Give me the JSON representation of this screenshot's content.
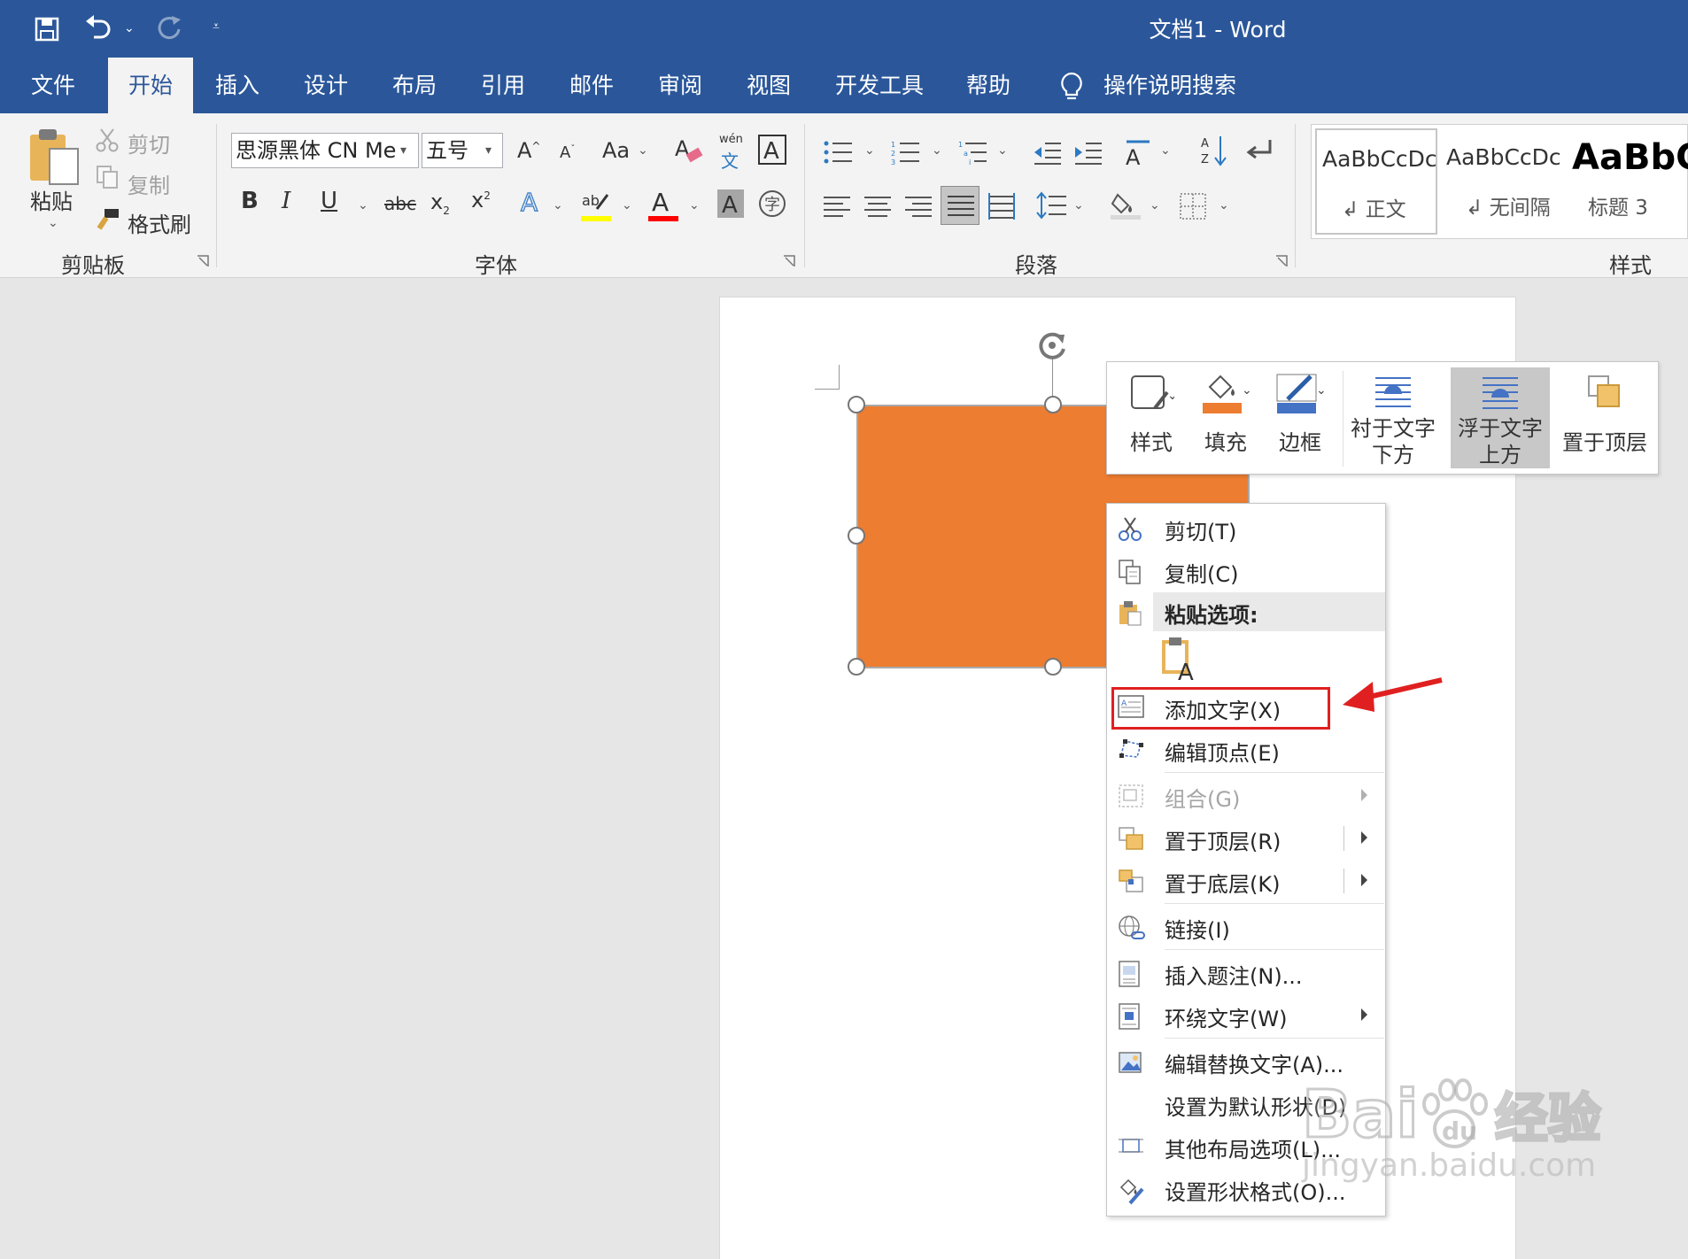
{
  "window": {
    "title": "文档1  -  Word"
  },
  "tabs": [
    {
      "label": "文件"
    },
    {
      "label": "开始"
    },
    {
      "label": "插入"
    },
    {
      "label": "设计"
    },
    {
      "label": "布局"
    },
    {
      "label": "引用"
    },
    {
      "label": "邮件"
    },
    {
      "label": "审阅"
    },
    {
      "label": "视图"
    },
    {
      "label": "开发工具"
    },
    {
      "label": "帮助"
    }
  ],
  "search": {
    "label": "操作说明搜索"
  },
  "clipboard": {
    "paste": "粘贴",
    "cut": "剪切",
    "copy": "复制",
    "format_painter": "格式刷",
    "group": "剪贴板"
  },
  "font": {
    "name": "思源黑体 CN Me",
    "size": "五号",
    "case_label": "Aa",
    "phonetic_top": "wén",
    "phonetic_bottom": "文",
    "group": "字体"
  },
  "paragraph": {
    "group": "段落"
  },
  "styles": {
    "items": [
      {
        "preview": "AaBbCcDc",
        "name": "正文"
      },
      {
        "preview": "AaBbCcDc",
        "name": "无间隔"
      },
      {
        "preview": "AaBbC",
        "name": "标题 3"
      }
    ],
    "group": "样式"
  },
  "minibar": {
    "style": "样式",
    "fill": "填充",
    "border": "边框",
    "behind_text_1": "衬于文字",
    "behind_text_2": "下方",
    "front_text_1": "浮于文字",
    "front_text_2": "上方",
    "bring_front": "置于顶层"
  },
  "context_menu": {
    "cut": "剪切(T)",
    "copy": "复制(C)",
    "paste_options": "粘贴选项:",
    "add_text": "添加文字(X)",
    "edit_points": "编辑顶点(E)",
    "group": "组合(G)",
    "bring_front": "置于顶层(R)",
    "send_back": "置于底层(K)",
    "link": "链接(I)",
    "insert_caption": "插入题注(N)...",
    "wrap_text": "环绕文字(W)",
    "edit_alt_text": "编辑替换文字(A)...",
    "set_default_shape": "设置为默认形状(D)",
    "more_layout": "其他布局选项(L)...",
    "format_shape": "设置形状格式(O)..."
  },
  "watermark": {
    "brand": "Bai",
    "brand_tail": "经验",
    "url": "jingyan.baidu.com"
  },
  "colors": {
    "ribbon_blue": "#2b579a",
    "shape_fill": "#ed7d31",
    "highlight_red": "#e02020",
    "highlight_yellow": "#ffff00",
    "font_red": "#ff0000"
  }
}
